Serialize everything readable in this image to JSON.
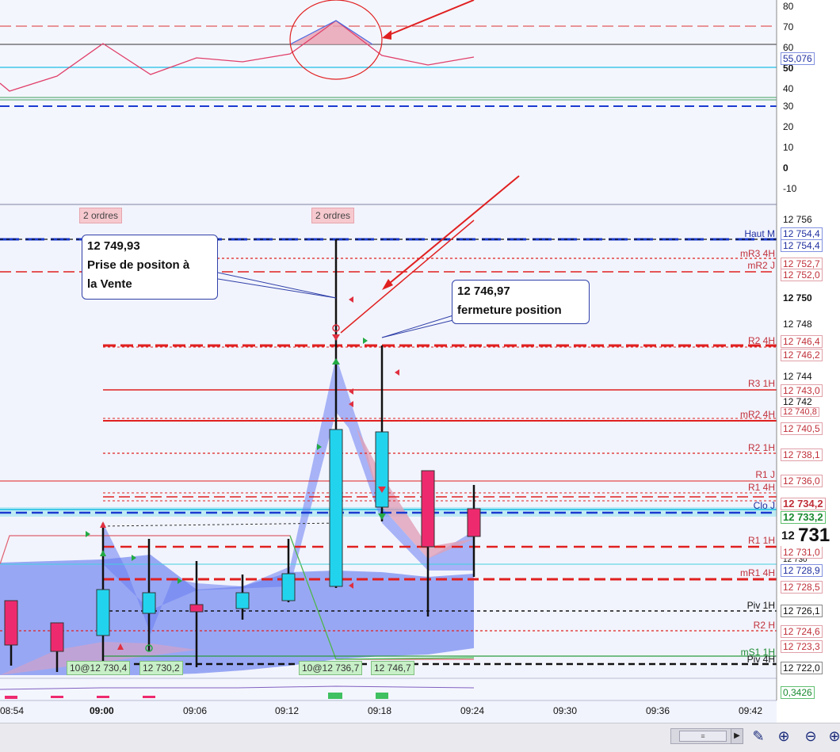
{
  "oscillator": {
    "y_ticks": [
      "80",
      "70",
      "60",
      "50",
      "40",
      "30",
      "20",
      "10",
      "0",
      "-10"
    ],
    "current_value": "55,076"
  },
  "price_axis": {
    "ticks": [
      "12 756",
      "12 750",
      "12 748",
      "12 744",
      "12 742",
      "12 730"
    ],
    "current_price_prefix": "12",
    "current_price_big": "731",
    "labels": [
      {
        "text": "12 754,4",
        "color": "#2030a0"
      },
      {
        "text": "12 754,4",
        "color": "#2030a0"
      },
      {
        "text": "12 752,7",
        "color": "#c0303a"
      },
      {
        "text": "12 752,0",
        "color": "#c0303a"
      },
      {
        "text": "12 746,4",
        "color": "#c0303a"
      },
      {
        "text": "12 746,2",
        "color": "#c0303a"
      },
      {
        "text": "12 743,0",
        "color": "#c0303a"
      },
      {
        "text": "12 740,8",
        "color": "#c0303a"
      },
      {
        "text": "12 740,5",
        "color": "#c0303a"
      },
      {
        "text": "12 738,1",
        "color": "#c0303a"
      },
      {
        "text": "12 736,0",
        "color": "#c0303a"
      },
      {
        "text": "12 734,2",
        "color": "#c0303a"
      },
      {
        "text": "12 733,2",
        "color": "#1a8a30"
      },
      {
        "text": "12 731,0",
        "color": "#c0303a"
      },
      {
        "text": "12 728,9",
        "color": "#2030a0"
      },
      {
        "text": "12 728,5",
        "color": "#c0303a"
      },
      {
        "text": "12 726,1",
        "color": "#111111"
      },
      {
        "text": "12 724,6",
        "color": "#c0303a"
      },
      {
        "text": "12 723,3",
        "color": "#c0303a"
      },
      {
        "text": "12 722,0",
        "color": "#111111"
      }
    ],
    "volume_value": "0,3426"
  },
  "line_labels": {
    "haut_m": "Haut M",
    "mr3_4h": "mR3 4H",
    "mr2_j": "mR2 J",
    "r2_4h": "R2 4H",
    "r3_1h": "R3 1H",
    "mr2_4h": "mR2 4H",
    "r2_1h": "R2 1H",
    "r1_j": "R1 J",
    "r1_4h": "R1 4H",
    "clo_j": "Clo J",
    "r1_1h": "R1 1H",
    "mr1_4h": "mR1 4H",
    "piv_1h": "Piv 1H",
    "r2_h": "R2 H",
    "ms1_1h": "mS1 1H",
    "piv_4h": "Piv 4H"
  },
  "order_badges": [
    "2 ordres",
    "2 ordres"
  ],
  "callouts": {
    "sell": {
      "price": "12 749,93",
      "line1": "Prise de positon à",
      "line2": "la Vente"
    },
    "close": {
      "price": "12 746,97",
      "line1": "fermeture position"
    }
  },
  "trade_tags": [
    "10@12 730,4",
    "12 730,2",
    "10@12 736,7",
    "12 746,7"
  ],
  "time_axis": [
    "08:54",
    "09:00",
    "09:06",
    "09:12",
    "09:18",
    "09:24",
    "09:30",
    "09:36",
    "09:42"
  ],
  "colors": {
    "bull": "#22d3ee",
    "bear": "#ee2a6e",
    "resistance": "#e02020",
    "support": "#1a3ad0"
  }
}
